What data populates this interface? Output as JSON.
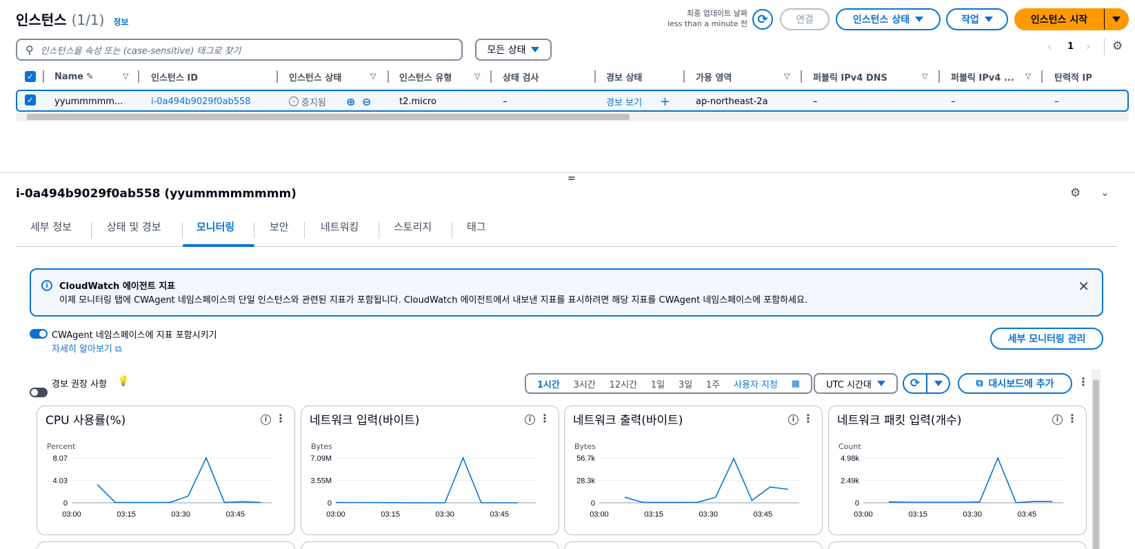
{
  "header": {
    "title": "인스턴스",
    "count": "(1/1)",
    "info": "정보",
    "last_updated_label": "최종 업데이트 날짜",
    "last_updated_value": "less than a minute 전",
    "connect": "연결",
    "instance_state": "인스턴스 상태",
    "actions": "작업",
    "launch": "인스턴스 시작"
  },
  "search": {
    "placeholder": "인스턴스을 속성 또는 (case-sensitive) 태그로 찾기"
  },
  "state_filter": "모든 상태",
  "pagination": {
    "page": "1"
  },
  "table": {
    "columns": [
      "Name",
      "인스턴스 ID",
      "인스턴스 상태",
      "인스턴스 유형",
      "상태 검사",
      "경보 상태",
      "가용 영역",
      "퍼블릭 IPv4 DNS",
      "퍼블릭 IPv4 ...",
      "탄력적 IP"
    ],
    "row": {
      "name": "yyummmmm...",
      "instance_id": "i-0a494b9029f0ab558",
      "state": "중지됨",
      "type": "t2.micro",
      "status_check": "–",
      "alarm": "경보 보기",
      "az": "ap-northeast-2a",
      "dns": "–",
      "ipv4": "–",
      "eip": "–"
    }
  },
  "detail": {
    "title": "i-0a494b9029f0ab558 (yyummmmmmmm)",
    "tabs": [
      "세부 정보",
      "상태 및 경보",
      "모니터링",
      "보안",
      "네트워킹",
      "스토리지",
      "태그"
    ],
    "active_tab": "모니터링"
  },
  "alert": {
    "title": "CloudWatch 에이전트 지표",
    "body": "이제 모니터링 탭에 CWAgent 네임스페이스의 단일 인스턴스와 관련된 지표가 포함됩니다. CloudWatch 에이전트에서 내보낸 지표를 표시하려면 해당 지표를 CWAgent 네임스페이스에 포함하세요."
  },
  "cwagent": {
    "toggle_label": "CWAgent 네임스페이스에 지표 포함시키기",
    "toggle_on": true,
    "learn_more": "자세히 알아보기",
    "manage_button": "세부 모니터링 관리"
  },
  "alarm_reco": {
    "label": "경보 권장 사항",
    "toggle_on": false
  },
  "time_range": {
    "options": [
      "1시간",
      "3시간",
      "12시간",
      "1일",
      "3일",
      "1주",
      "사용자 지정"
    ],
    "selected": "1시간",
    "timezone": "UTC 시간대",
    "add_dashboard": "대시보드에 추가"
  },
  "colors": {
    "accent": "#0972d3",
    "primary": "#ff9900",
    "line": "#0972d3"
  },
  "charts": [
    {
      "title": "CPU 사용률(%)",
      "unit": "Percent",
      "yticks": [
        "8.07",
        "4.03",
        "0"
      ],
      "xticks": [
        "03:00",
        "03:15",
        "03:30",
        "03:45"
      ]
    },
    {
      "title": "네트워크 입력(바이트)",
      "unit": "Bytes",
      "yticks": [
        "7.09M",
        "3.55M",
        "0"
      ],
      "xticks": [
        "03:00",
        "03:15",
        "03:30",
        "03:45"
      ]
    },
    {
      "title": "네트워크 출력(바이트)",
      "unit": "Bytes",
      "yticks": [
        "56.7k",
        "28.3k",
        "0"
      ],
      "xticks": [
        "03:00",
        "03:15",
        "03:30",
        "03:45"
      ]
    },
    {
      "title": "네트워크 패킷 입력(개수)",
      "unit": "Count",
      "yticks": [
        "4.98k",
        "2.49k",
        "0"
      ],
      "xticks": [
        "03:00",
        "03:15",
        "03:30",
        "03:45"
      ]
    }
  ],
  "chart_data": [
    {
      "type": "line",
      "title": "CPU 사용률(%)",
      "ylabel": "Percent",
      "ylim": [
        0,
        8.07
      ],
      "x": [
        "03:07",
        "03:12",
        "03:17",
        "03:22",
        "03:27",
        "03:32",
        "03:37",
        "03:42",
        "03:47",
        "03:52"
      ],
      "values": [
        3.3,
        0.05,
        0.05,
        0.05,
        0.05,
        1.2,
        8.07,
        0.05,
        0.2,
        0.05
      ]
    },
    {
      "type": "line",
      "title": "네트워크 입력(바이트)",
      "ylabel": "Bytes",
      "ylim": [
        0,
        7090000
      ],
      "x": [
        "03:00",
        "03:05",
        "03:10",
        "03:15",
        "03:20",
        "03:25",
        "03:30",
        "03:35",
        "03:40",
        "03:45",
        "03:50"
      ],
      "values": [
        50000,
        40000,
        30000,
        20000,
        10000,
        5000,
        0,
        7090000,
        0,
        0,
        0
      ]
    },
    {
      "type": "line",
      "title": "네트워크 출력(바이트)",
      "ylabel": "Bytes",
      "ylim": [
        0,
        56700
      ],
      "x": [
        "03:07",
        "03:12",
        "03:17",
        "03:22",
        "03:27",
        "03:32",
        "03:37",
        "03:42",
        "03:47",
        "03:52"
      ],
      "values": [
        7000,
        500,
        500,
        500,
        500,
        7000,
        56000,
        3000,
        20000,
        17000
      ]
    },
    {
      "type": "line",
      "title": "네트워크 패킷 입력(개수)",
      "ylabel": "Count",
      "ylim": [
        0,
        4980
      ],
      "x": [
        "03:07",
        "03:12",
        "03:17",
        "03:22",
        "03:27",
        "03:32",
        "03:37",
        "03:42",
        "03:47",
        "03:52"
      ],
      "values": [
        100,
        50,
        50,
        50,
        50,
        100,
        4980,
        20,
        150,
        150
      ]
    }
  ]
}
